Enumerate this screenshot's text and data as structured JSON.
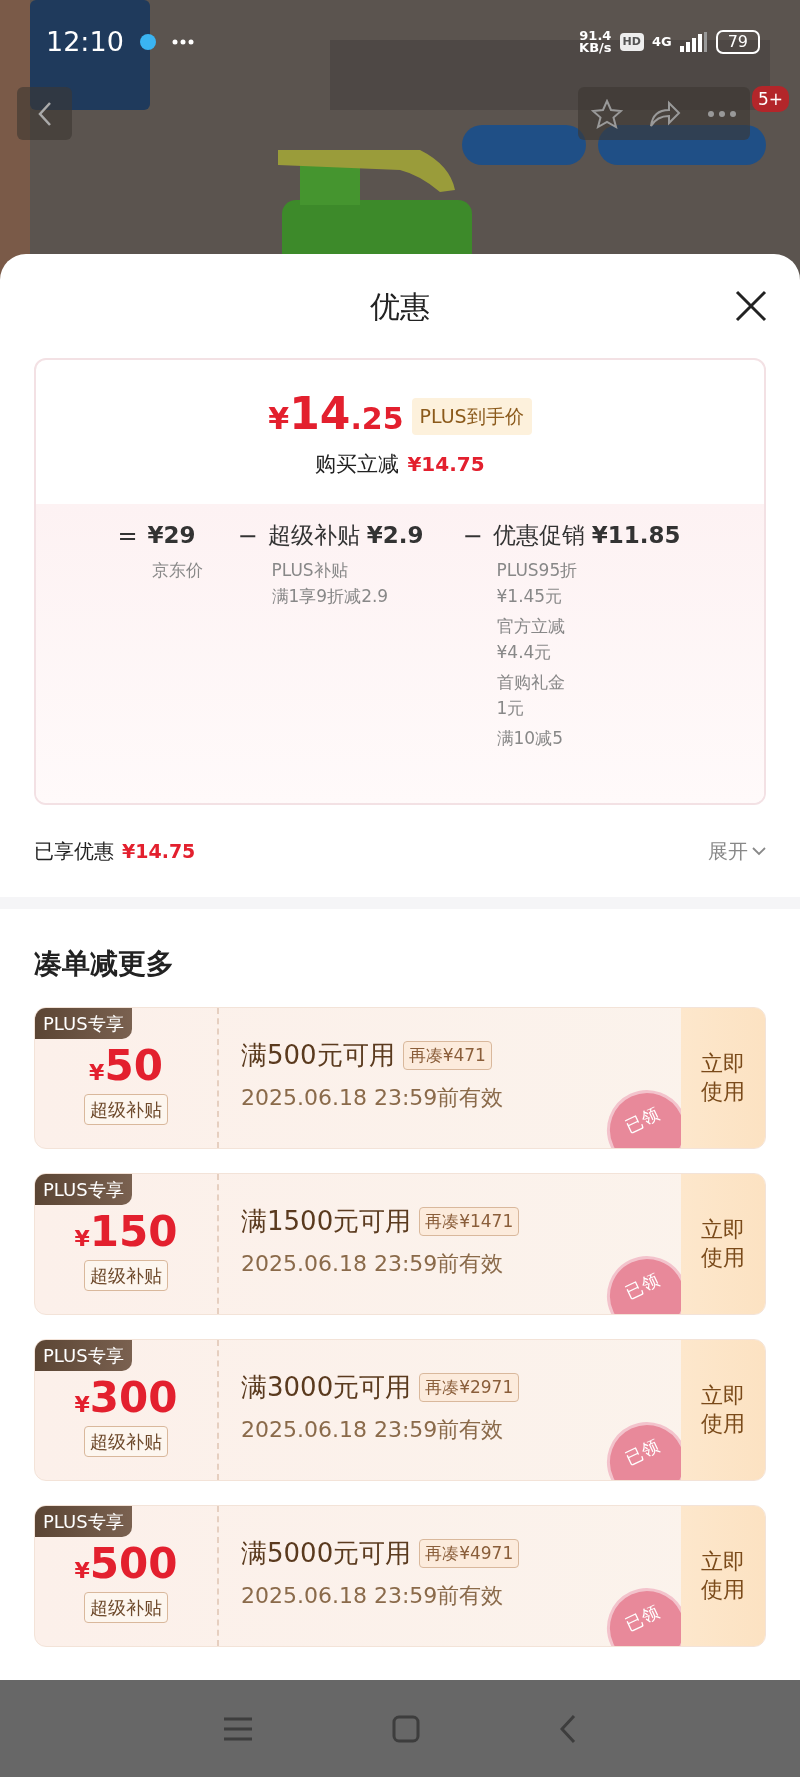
{
  "status_bar": {
    "time": "12:10",
    "speed_value": "91.4",
    "speed_unit": "KB/s",
    "hd": "HD",
    "network": "4G",
    "battery": "79"
  },
  "header": {
    "badge": "5+"
  },
  "sheet": {
    "title": "优惠",
    "price": {
      "currency": "¥",
      "integer": "14",
      "decimal": ".25",
      "tag": "PLUS到手价",
      "reduction_label": "购买立减",
      "reduction": "¥14.75"
    },
    "breakdown": [
      {
        "operator": "=",
        "value": "¥29",
        "notes": [
          {
            "lines": [
              "京东价"
            ]
          }
        ]
      },
      {
        "operator": "−",
        "label": "超级补贴",
        "value": "¥2.9",
        "notes": [
          {
            "lines": [
              "PLUS补贴",
              "满1享9折减2.9"
            ]
          }
        ]
      },
      {
        "operator": "−",
        "label": "优惠促销",
        "value": "¥11.85",
        "notes": [
          {
            "lines": [
              "PLUS95折",
              "¥1.45元"
            ]
          },
          {
            "lines": [
              "官方立减",
              "¥4.4元"
            ]
          },
          {
            "lines": [
              "首购礼金",
              "1元"
            ]
          },
          {
            "lines": [
              "满10减5"
            ]
          }
        ]
      }
    ],
    "summary": {
      "label": "已享优惠",
      "value": "¥14.75",
      "toggle": "展开"
    }
  },
  "section": {
    "title": "凑单减更多",
    "coupons": [
      {
        "badge": "PLUS专享",
        "currency": "¥",
        "amount": "50",
        "tag": "超级补贴",
        "title": "满500元可用",
        "extra": "再凑¥471",
        "validity": "2025.06.18 23:59前有效",
        "button": "立即使用",
        "stamp": "已领"
      },
      {
        "badge": "PLUS专享",
        "currency": "¥",
        "amount": "150",
        "tag": "超级补贴",
        "title": "满1500元可用",
        "extra": "再凑¥1471",
        "validity": "2025.06.18 23:59前有效",
        "button": "立即使用",
        "stamp": "已领"
      },
      {
        "badge": "PLUS专享",
        "currency": "¥",
        "amount": "300",
        "tag": "超级补贴",
        "title": "满3000元可用",
        "extra": "再凑¥2971",
        "validity": "2025.06.18 23:59前有效",
        "button": "立即使用",
        "stamp": "已领"
      },
      {
        "badge": "PLUS专享",
        "currency": "¥",
        "amount": "500",
        "tag": "超级补贴",
        "title": "满5000元可用",
        "extra": "再凑¥4971",
        "validity": "2025.06.18 23:59前有效",
        "button": "立即使用",
        "stamp": "已领"
      }
    ]
  }
}
